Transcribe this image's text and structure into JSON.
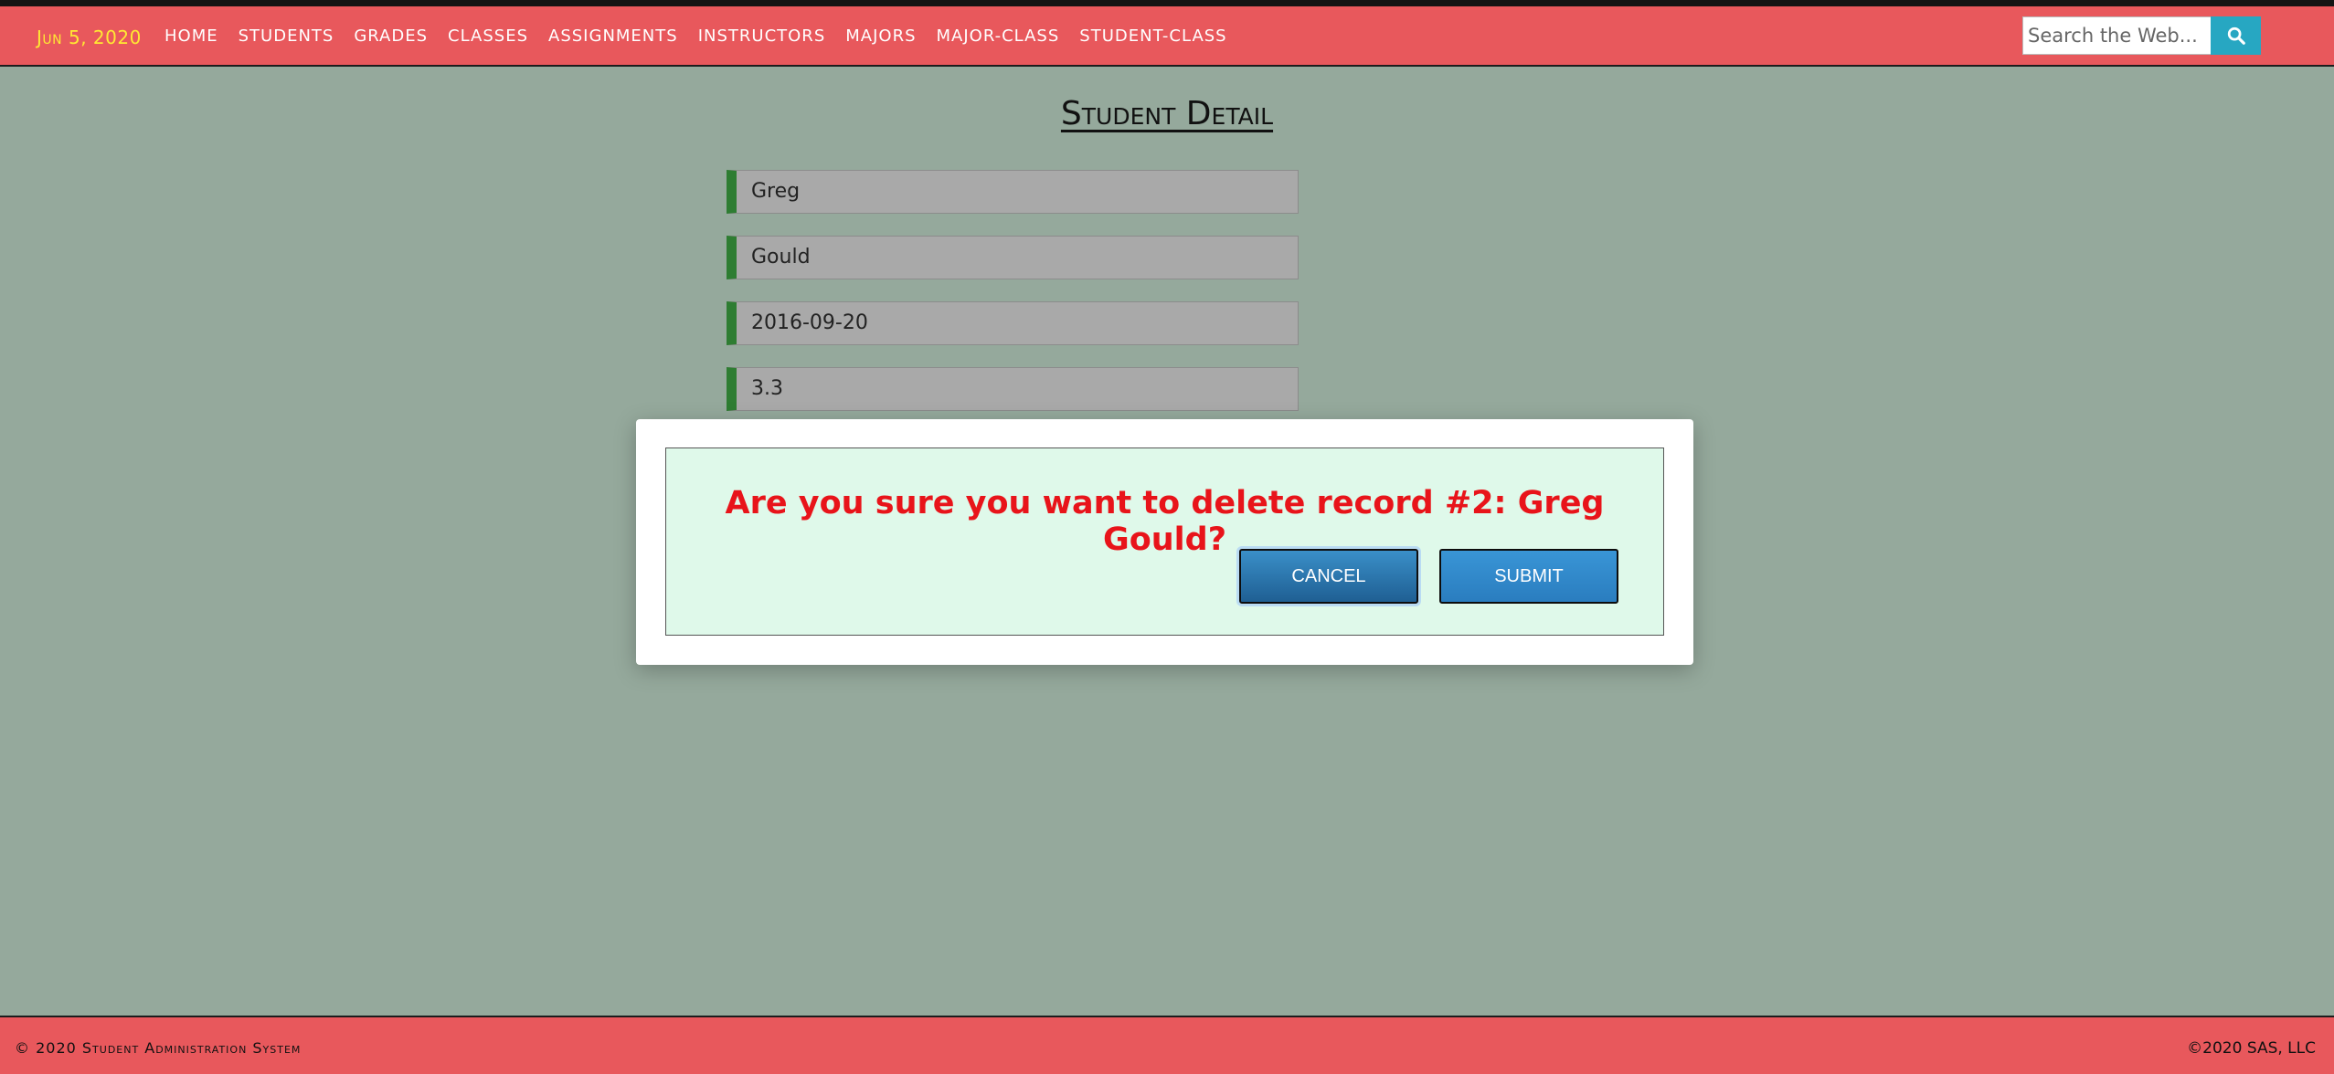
{
  "nav": {
    "date": "Jun 5, 2020",
    "links": [
      "Home",
      "Students",
      "Grades",
      "Classes",
      "Assignments",
      "Instructors",
      "Majors",
      "Major-Class",
      "Student-Class"
    ],
    "search_placeholder": "Search the Web...",
    "search_icon": "search-icon"
  },
  "page": {
    "title": "Student Detail",
    "fields": [
      "Greg",
      "Gould",
      "2016-09-20",
      "3.3"
    ]
  },
  "modal": {
    "message": "Are you sure you want to delete record #2: Greg Gould?",
    "cancel_label": "Cancel",
    "submit_label": "Submit"
  },
  "footer": {
    "left": "© 2020 Student Administration System",
    "right": "©2020 SAS, LLC"
  },
  "colors": {
    "navbar": "#e8585c",
    "background": "#95a99c",
    "date": "#ffe833",
    "field_accent": "#2e7d32",
    "modal_message": "#e8141a",
    "button": "#2a7dbf",
    "search_button": "#27a7c2"
  }
}
